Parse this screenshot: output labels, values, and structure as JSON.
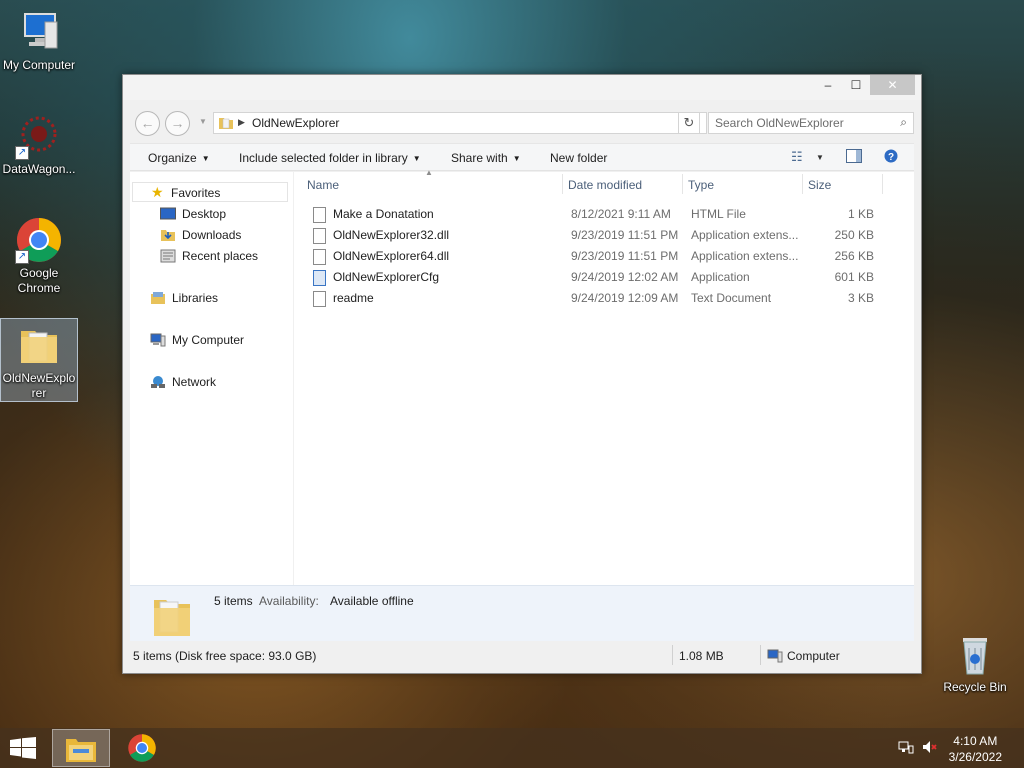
{
  "desktop": {
    "icons": [
      {
        "label": "My Computer"
      },
      {
        "label": "DataWagon..."
      },
      {
        "label": "Google Chrome"
      },
      {
        "label": "OldNewExplorer"
      },
      {
        "label": "Recycle Bin"
      }
    ]
  },
  "window": {
    "controls": {
      "minimize": "–",
      "maximize": "☐",
      "close": "✕"
    },
    "address": {
      "crumb": "OldNewExplorer"
    },
    "search": {
      "placeholder": "Search OldNewExplorer"
    },
    "toolbar": {
      "organize": "Organize",
      "include": "Include selected folder in library",
      "share": "Share with",
      "new_folder": "New folder"
    },
    "nav": {
      "favorites": "Favorites",
      "desktop": "Desktop",
      "downloads": "Downloads",
      "recent": "Recent places",
      "libraries": "Libraries",
      "computer": "My Computer",
      "network": "Network"
    },
    "columns": {
      "name": "Name",
      "date": "Date modified",
      "type": "Type",
      "size": "Size"
    },
    "files": [
      {
        "name": "Make a Donatation",
        "date": "8/12/2021 9:11 AM",
        "type": "HTML File",
        "size": "1 KB",
        "icon": "html-file-icon"
      },
      {
        "name": "OldNewExplorer32.dll",
        "date": "9/23/2019 11:51 PM",
        "type": "Application extens...",
        "size": "250 KB",
        "icon": "dll-file-icon"
      },
      {
        "name": "OldNewExplorer64.dll",
        "date": "9/23/2019 11:51 PM",
        "type": "Application extens...",
        "size": "256 KB",
        "icon": "dll-file-icon"
      },
      {
        "name": "OldNewExplorerCfg",
        "date": "9/24/2019 12:02 AM",
        "type": "Application",
        "size": "601 KB",
        "icon": "app-icon"
      },
      {
        "name": "readme",
        "date": "9/24/2019 12:09 AM",
        "type": "Text Document",
        "size": "3 KB",
        "icon": "text-file-icon"
      }
    ],
    "details": {
      "count": "5 items",
      "availability_label": "Availability:",
      "availability_value": "Available offline"
    },
    "status": {
      "items": "5 items (Disk free space: 93.0 GB)",
      "size": "1.08 MB",
      "location": "Computer"
    }
  },
  "taskbar": {
    "time": "4:10 AM",
    "date": "3/26/2022"
  }
}
